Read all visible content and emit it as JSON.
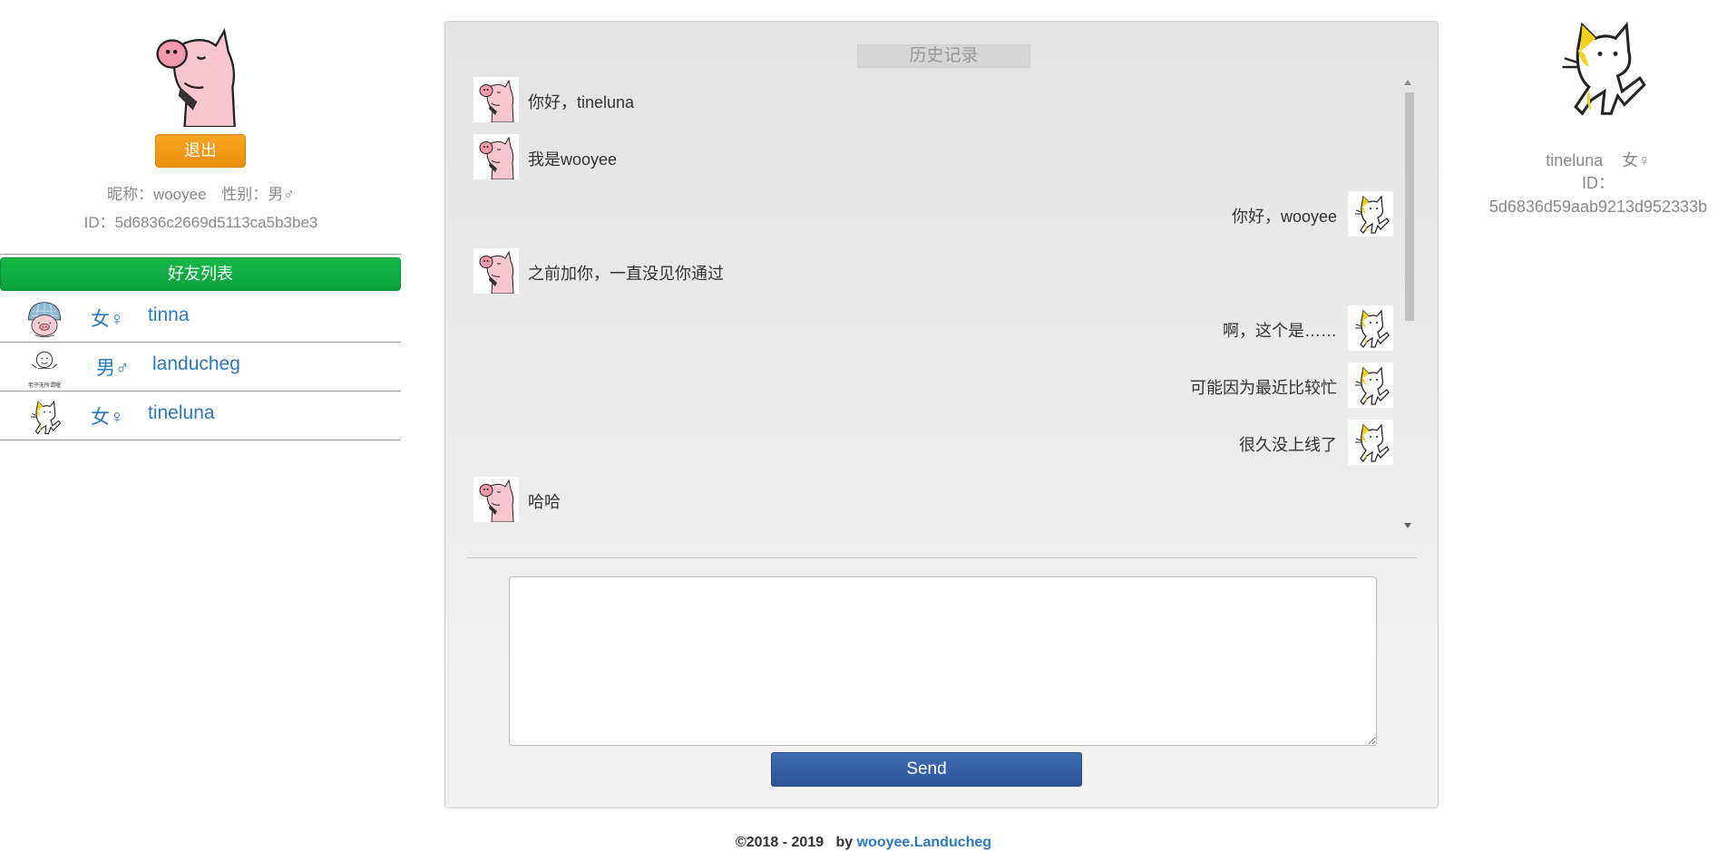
{
  "me": {
    "logout_label": "退出",
    "nickname_label": "昵称：wooyee",
    "gender_label": "性别：男♂",
    "id_label": "ID：5d6836c2669d5113ca5b3be3"
  },
  "friends": {
    "header": "好友列表",
    "items": [
      {
        "gender": "女♀",
        "name": "tinna",
        "avatar": "helmet-pig-avatar"
      },
      {
        "gender": "男♂",
        "name": "landucheg",
        "avatar": "smiley-face-avatar",
        "avatar_caption": "老子无所谓喔"
      },
      {
        "gender": "女♀",
        "name": "tineluna",
        "avatar": "yellow-cat-avatar"
      }
    ]
  },
  "chat": {
    "history_label": "历史记录",
    "messages": [
      {
        "side": "left",
        "text": "你好，tineluna"
      },
      {
        "side": "left",
        "text": "我是wooyee"
      },
      {
        "side": "right",
        "text": "你好，wooyee"
      },
      {
        "side": "left",
        "text": "之前加你，一直没见你通过"
      },
      {
        "side": "right",
        "text": "啊，这个是……"
      },
      {
        "side": "right",
        "text": "可能因为最近比较忙"
      },
      {
        "side": "right",
        "text": "很久没上线了"
      },
      {
        "side": "left",
        "text": "哈哈"
      }
    ],
    "input_value": "",
    "send_label": "Send"
  },
  "peer": {
    "name": "tineluna",
    "gender": "女♀",
    "id_label": "ID：",
    "id_value": "5d6836d59aab9213d952333b"
  },
  "footer": {
    "copyright": "©2018 - 2019",
    "by": "by",
    "link": "wooyee.Landucheg"
  },
  "colors": {
    "link_blue": "#2a78bd",
    "logout_orange": "#f0a020",
    "friends_green": "#0fb043",
    "send_blue": "#3462a4"
  }
}
